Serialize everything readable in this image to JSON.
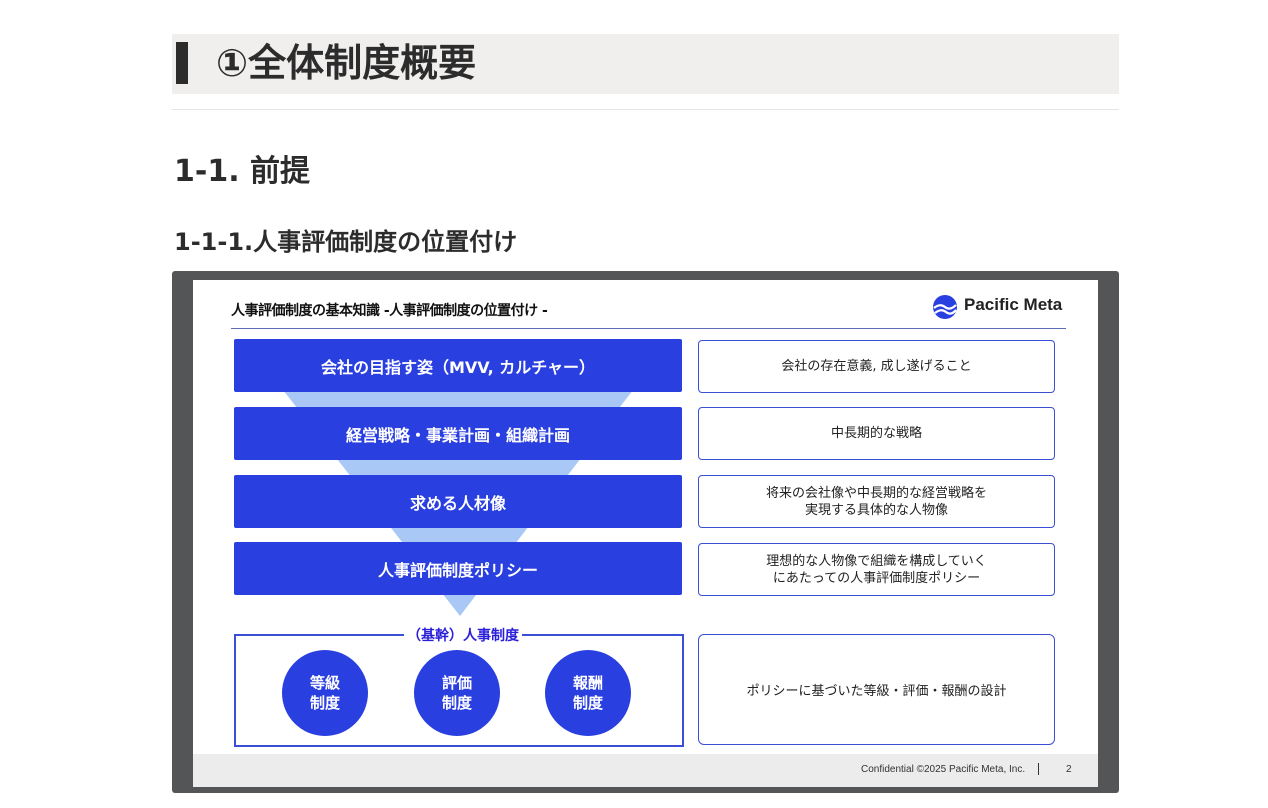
{
  "heading1": "①全体制度概要",
  "heading2": "1-1. 前提",
  "heading3": "1-1-1.人事評価制度の位置付け",
  "slide": {
    "title": "人事評価制度の基本知識 -人事評価制度の位置付け -",
    "logo": {
      "name": "Pacific Meta",
      "icon": "pacific-meta-logo-icon"
    },
    "levels": [
      {
        "label": "会社の目指す姿（MVV, カルチャー）",
        "desc": [
          "会社の存在意義, 成し遂げること"
        ]
      },
      {
        "label": "経営戦略・事業計画・組織計画",
        "desc": [
          "中長期的な戦略"
        ]
      },
      {
        "label": "求める人材像",
        "desc": [
          "将来の会社像や中長期的な経営戦略を",
          "実現する具体的な人物像"
        ]
      },
      {
        "label": "人事評価制度ポリシー",
        "desc": [
          "理想的な人物像で組織を構成していく",
          "にあたっての人事評価制度ポリシー"
        ]
      }
    ],
    "core": {
      "label": "（基幹）人事制度",
      "circles": [
        {
          "line1": "等級",
          "line2": "制度"
        },
        {
          "line1": "評価",
          "line2": "制度"
        },
        {
          "line1": "報酬",
          "line2": "制度"
        }
      ],
      "desc": "ポリシーに基づいた等級・評価・報酬の設計"
    },
    "footer": {
      "confidential": "Confidential ©2025 Pacific Meta, Inc.",
      "page": "2"
    }
  },
  "colors": {
    "accent": "#2a3fe0",
    "funnel": "#a9c8f5",
    "heading_bg": "#f0efed",
    "slide_frame": "#545556"
  }
}
